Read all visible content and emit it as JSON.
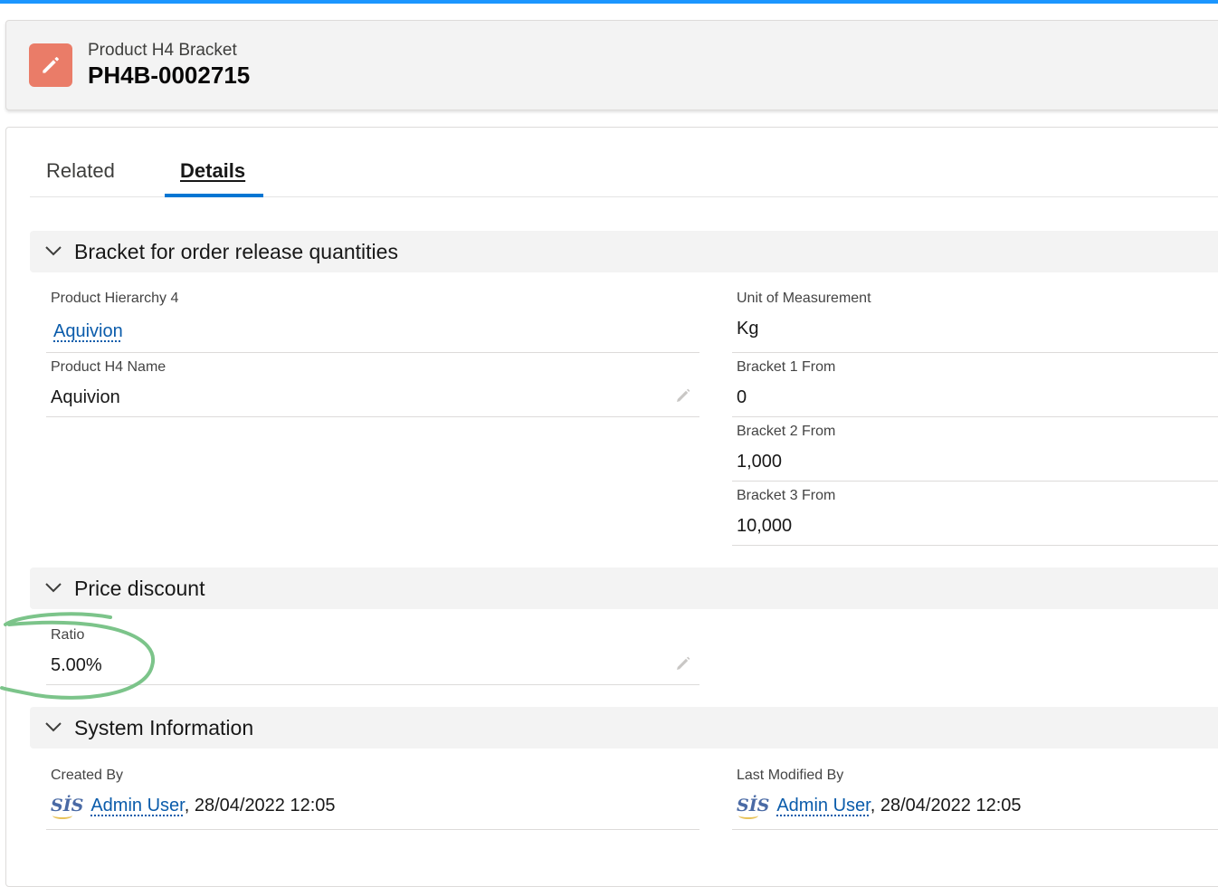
{
  "header": {
    "object_name": "Product H4 Bracket",
    "record_name": "PH4B-0002715",
    "icon": "pencil-edit-icon"
  },
  "tabs": [
    {
      "label": "Related",
      "selected": false
    },
    {
      "label": "Details",
      "selected": true
    }
  ],
  "sections": {
    "bracket": {
      "title": "Bracket for order release quantities",
      "fields": {
        "product_hierarchy_4": {
          "label": "Product Hierarchy 4",
          "value": "Aquivion"
        },
        "unit_of_measurement": {
          "label": "Unit of Measurement",
          "value": "Kg"
        },
        "product_h4_name": {
          "label": "Product H4 Name",
          "value": "Aquivion"
        },
        "bracket_1_from": {
          "label": "Bracket 1 From",
          "value": "0"
        },
        "bracket_2_from": {
          "label": "Bracket 2 From",
          "value": "1,000"
        },
        "bracket_3_from": {
          "label": "Bracket 3 From",
          "value": "10,000"
        }
      }
    },
    "price_discount": {
      "title": "Price discount",
      "fields": {
        "ratio": {
          "label": "Ratio",
          "value": "5.00%"
        }
      }
    },
    "system": {
      "title": "System Information",
      "fields": {
        "created_by": {
          "label": "Created By",
          "logo": "SİS",
          "user": "Admin User",
          "date": ", 28/04/2022 12:05"
        },
        "last_modified_by": {
          "label": "Last Modified By",
          "logo": "SİS",
          "user": "Admin User",
          "date": ", 28/04/2022 12:05"
        }
      }
    }
  },
  "colors": {
    "accent": "#0176d3",
    "top_bar": "#1b96ff",
    "icon_bg": "#ea7c68",
    "link": "#0b5cab",
    "annotation": "#7cc48a"
  }
}
